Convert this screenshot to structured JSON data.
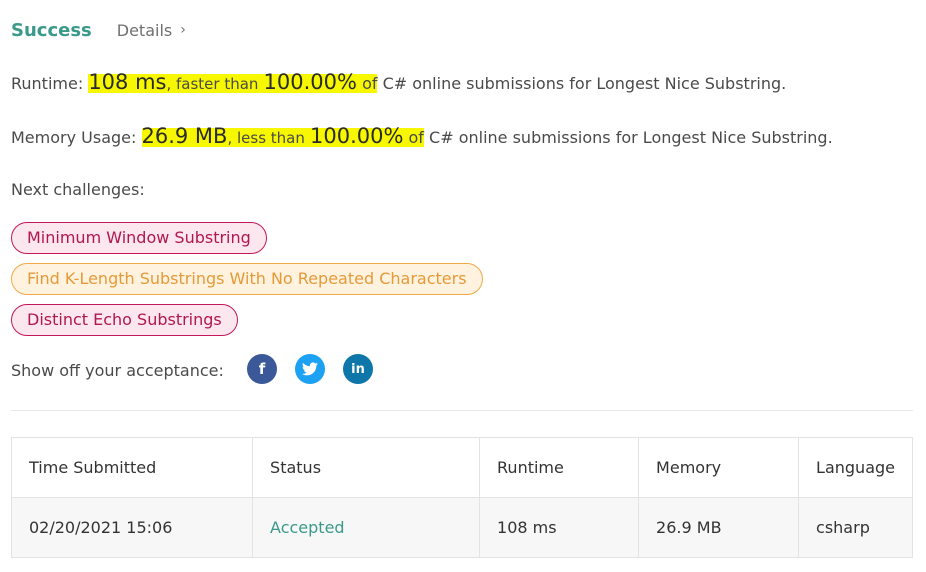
{
  "header": {
    "status": "Success",
    "details": "Details"
  },
  "runtime": {
    "label": "Runtime:",
    "value": "108 ms",
    "sep": ", faster than",
    "percent": "100.00%",
    "of": "of",
    "rest": "C# online submissions for Longest Nice Substring."
  },
  "memory": {
    "label": "Memory Usage:",
    "value": "26.9 MB",
    "sep": ", less than",
    "percent": "100.00%",
    "of": "of",
    "rest": "C# online submissions for Longest Nice Substring."
  },
  "next": {
    "title": "Next challenges:",
    "items": [
      "Minimum Window Substring",
      "Find K-Length Substrings With No Repeated Characters",
      "Distinct Echo Substrings"
    ]
  },
  "share": {
    "label": "Show off your acceptance:",
    "icons": [
      "facebook-icon",
      "twitter-icon",
      "linkedin-icon"
    ]
  },
  "table": {
    "headers": [
      "Time Submitted",
      "Status",
      "Runtime",
      "Memory",
      "Language"
    ],
    "rows": [
      [
        "02/20/2021 15:06",
        "Accepted",
        "108 ms",
        "26.9 MB",
        "csharp"
      ]
    ]
  },
  "colors": {
    "accent": "#3a9a8a",
    "highlight": "#f7f700",
    "chip_pink": "#c2185b",
    "chip_orange": "#f0a94a"
  }
}
